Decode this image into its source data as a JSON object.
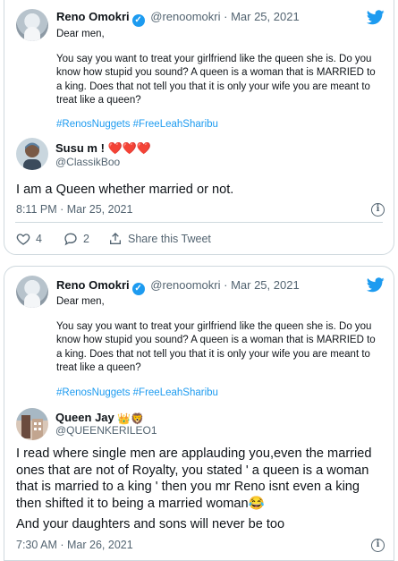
{
  "quoted_tweet": {
    "author_name": "Reno Omokri",
    "author_handle": "@renoomokri",
    "separator": "·",
    "date": "Mar 25, 2021",
    "greeting": "Dear men,",
    "body": "You say you want to treat your girlfriend like the queen she is. Do you know how stupid you sound? A queen is a woman that is MARRIED to a king. Does that not tell you that it is only your wife you are meant to treat like a queen?",
    "hashtags": "#RenosNuggets #FreeLeahSharibu"
  },
  "reply1": {
    "author_name": "Susu m !",
    "name_decoration": "❤️❤️❤️",
    "author_handle": "@ClassikBoo",
    "text": "I am a Queen whether married or not.",
    "time": "8:11 PM",
    "separator": "·",
    "date": "Mar 25, 2021",
    "likes": "4",
    "replies": "2",
    "share_label": "Share this Tweet"
  },
  "reply2": {
    "author_name": "Queen Jay",
    "name_decoration": "👑🦁",
    "author_handle": "@QUEENKERILEO1",
    "text_line1": "I read where single men are applauding you,even the married ones that are not of Royalty, you stated ' a queen is a woman that is married to a king ' then you mr Reno isnt even a king then shifted it to being a married woman😂",
    "text_line2": "And your daughters and sons will never be too",
    "time": "7:30 AM",
    "separator": "·",
    "date": "Mar 26, 2021"
  },
  "colors": {
    "twitter_blue": "#1d9bf0",
    "muted_text": "#536471",
    "border": "#cfd9de",
    "heart_red": "#e0245e"
  },
  "icons": [
    "verified-badge-icon",
    "twitter-bird-icon",
    "info-icon",
    "heart-icon",
    "reply-bubble-icon",
    "share-icon"
  ]
}
